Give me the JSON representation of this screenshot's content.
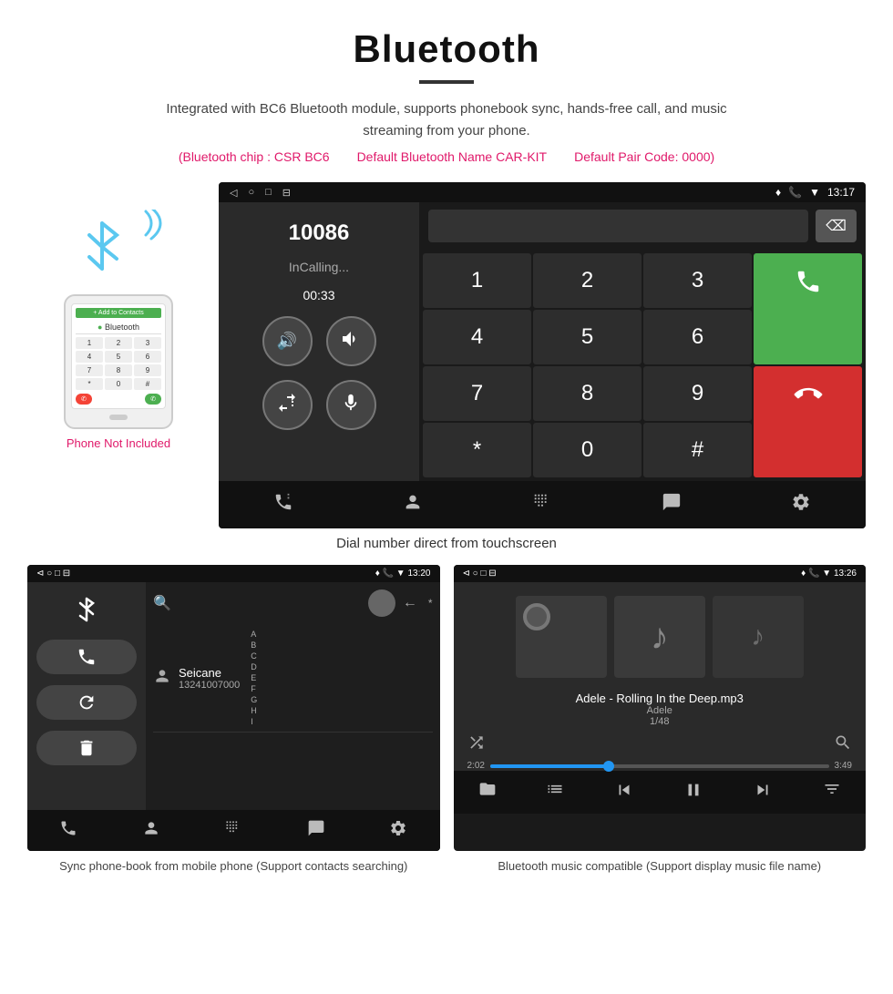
{
  "header": {
    "title": "Bluetooth",
    "description": "Integrated with BC6 Bluetooth module, supports phonebook sync, hands-free call, and music streaming from your phone.",
    "specs": [
      "(Bluetooth chip : CSR BC6",
      "Default Bluetooth Name CAR-KIT",
      "Default Pair Code: 0000)"
    ]
  },
  "phone": {
    "not_included_label": "Phone Not Included",
    "screen": {
      "add_contacts": "+ Add to Contacts"
    }
  },
  "dial_screen": {
    "statusbar": {
      "time": "13:17",
      "nav_icons": [
        "◁",
        "○",
        "□",
        "⊟"
      ]
    },
    "number": "10086",
    "status": "InCalling...",
    "timer": "00:33",
    "buttons": {
      "vol_up": "🔊",
      "vol_down": "🔉",
      "transfer": "📲",
      "mic": "🎤"
    },
    "keypad": [
      "1",
      "2",
      "3",
      "4",
      "5",
      "6",
      "7",
      "8",
      "9",
      "*",
      "0",
      "#"
    ],
    "call_btn": "📞",
    "end_btn": "📞"
  },
  "caption1": "Dial number direct from touchscreen",
  "phonebook_screen": {
    "statusbar_left": "⊲  ○  □  ⊟",
    "statusbar_right": "♦ 📞 ▼ 13:20",
    "contact_name": "Seicane",
    "contact_number": "13241007000",
    "alphabet": [
      "A",
      "B",
      "C",
      "D",
      "E",
      "F",
      "G",
      "H",
      "I"
    ]
  },
  "music_screen": {
    "statusbar_right": "13:26",
    "song_title": "Adele - Rolling In the Deep.mp3",
    "artist": "Adele",
    "track_info": "1/48",
    "time_current": "2:02",
    "time_total": "3:49"
  },
  "caption_phonebook": "Sync phone-book from mobile phone\n(Support contacts searching)",
  "caption_music": "Bluetooth music compatible\n(Support display music file name)"
}
